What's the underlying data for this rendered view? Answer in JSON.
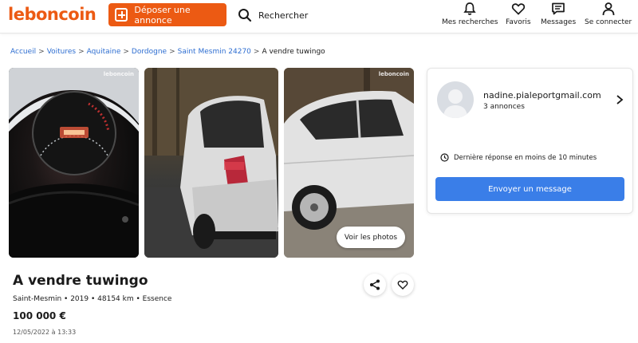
{
  "header": {
    "logo": "leboncoin",
    "post_label": "Déposer une annonce",
    "search_label": "Rechercher",
    "nav": [
      {
        "label": "Mes recherches",
        "icon": "bell-icon"
      },
      {
        "label": "Favoris",
        "icon": "heart-icon"
      },
      {
        "label": "Messages",
        "icon": "message-icon"
      },
      {
        "label": "Se connecter",
        "icon": "user-icon"
      }
    ]
  },
  "breadcrumb": {
    "items": [
      "Accueil",
      "Voitures",
      "Aquitaine",
      "Dordogne",
      "Saint Mesmin 24270"
    ],
    "current": "A vendre tuwingo"
  },
  "gallery": {
    "watermark": "leboncoin",
    "see_photos_label": "Voir les photos"
  },
  "listing": {
    "title": "A vendre tuwingo",
    "subtitle": "Saint-Mesmin • 2019 • 48154 km • Essence",
    "price": "100 000 €",
    "date": "12/05/2022 à 13:33"
  },
  "seller": {
    "name": "nadine.pialeportgmail.com",
    "count": "3 annonces",
    "reply_info": "Dernière réponse en moins de 10 minutes",
    "message_button": "Envoyer un message"
  },
  "colors": {
    "brand": "#ec5a13",
    "link": "#2e6ed1",
    "primary_button": "#3a7ee8"
  }
}
